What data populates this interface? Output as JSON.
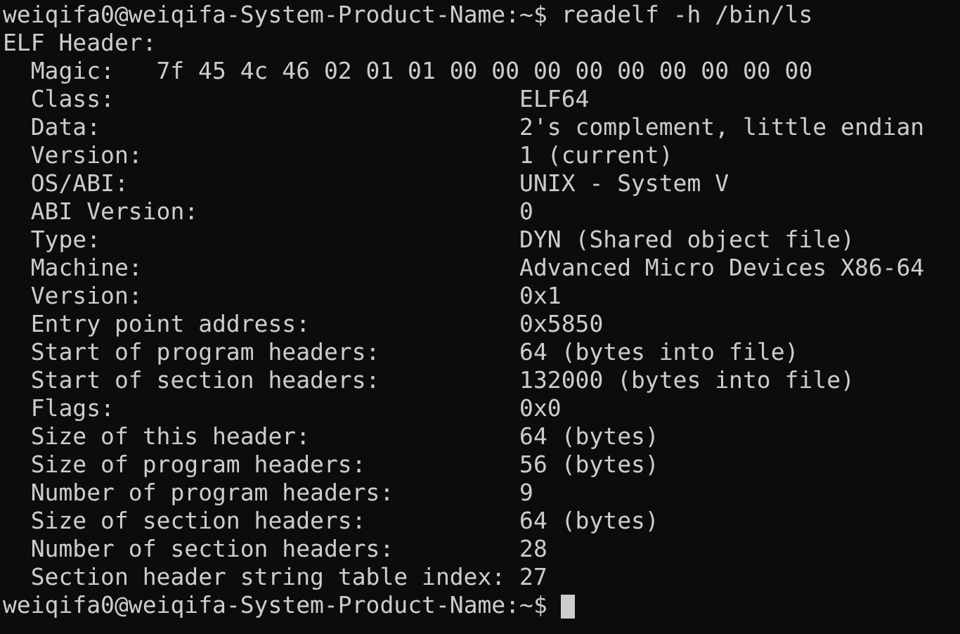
{
  "command": {
    "prompt": "weiqifa0@weiqifa-System-Product-Name:~$",
    "text": "readelf -h /bin/ls"
  },
  "section_title": "ELF Header:",
  "fields": [
    {
      "kind": "magic",
      "label": "Magic:",
      "value": "7f 45 4c 46 02 01 01 00 00 00 00 00 00 00 00 00"
    },
    {
      "kind": "field",
      "label": "Class:",
      "value": "ELF64"
    },
    {
      "kind": "field",
      "label": "Data:",
      "value": "2's complement, little endian"
    },
    {
      "kind": "field",
      "label": "Version:",
      "value": "1 (current)"
    },
    {
      "kind": "field",
      "label": "OS/ABI:",
      "value": "UNIX - System V"
    },
    {
      "kind": "field",
      "label": "ABI Version:",
      "value": "0"
    },
    {
      "kind": "field",
      "label": "Type:",
      "value": "DYN (Shared object file)"
    },
    {
      "kind": "field",
      "label": "Machine:",
      "value": "Advanced Micro Devices X86-64"
    },
    {
      "kind": "field",
      "label": "Version:",
      "value": "0x1"
    },
    {
      "kind": "field",
      "label": "Entry point address:",
      "value": "0x5850"
    },
    {
      "kind": "field",
      "label": "Start of program headers:",
      "value": "64 (bytes into file)"
    },
    {
      "kind": "field",
      "label": "Start of section headers:",
      "value": "132000 (bytes into file)"
    },
    {
      "kind": "field",
      "label": "Flags:",
      "value": "0x0"
    },
    {
      "kind": "field",
      "label": "Size of this header:",
      "value": "64 (bytes)"
    },
    {
      "kind": "field",
      "label": "Size of program headers:",
      "value": "56 (bytes)"
    },
    {
      "kind": "field",
      "label": "Number of program headers:",
      "value": "9"
    },
    {
      "kind": "field",
      "label": "Size of section headers:",
      "value": "64 (bytes)"
    },
    {
      "kind": "field",
      "label": "Number of section headers:",
      "value": "28"
    },
    {
      "kind": "field",
      "label": "Section header string table index:",
      "value": "27"
    }
  ],
  "final_prompt": {
    "prompt": "weiqifa0@weiqifa-System-Product-Name:~$",
    "cursor": true
  }
}
